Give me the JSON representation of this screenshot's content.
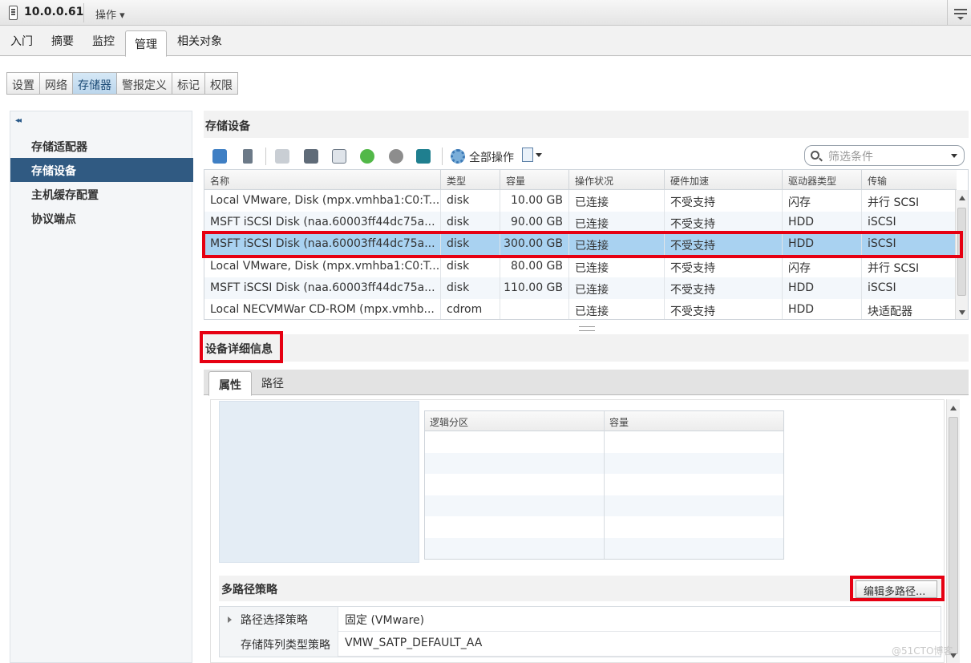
{
  "topbar": {
    "host": "10.0.0.61",
    "actions": "操作 ▾"
  },
  "main_tabs": [
    "入门",
    "摘要",
    "监控",
    "管理",
    "相关对象"
  ],
  "sub_tabs": [
    "设置",
    "网络",
    "存储器",
    "警报定义",
    "标记",
    "权限"
  ],
  "left_nav": {
    "collapse": "◂◂",
    "items": [
      "存储适配器",
      "存储设备",
      "主机缓存配置",
      "协议端点"
    ]
  },
  "storage": {
    "title": "存储设备",
    "all_actions": "全部操作",
    "filter_placeholder": "筛选条件",
    "columns": [
      "名称",
      "类型",
      "容量",
      "操作状况",
      "硬件加速",
      "驱动器类型",
      "传输"
    ],
    "rows": [
      [
        "Local VMware, Disk (mpx.vmhba1:C0:T...",
        "disk",
        "10.00 GB",
        "已连接",
        "不受支持",
        "闪存",
        "并行 SCSI"
      ],
      [
        "MSFT iSCSI Disk (naa.60003ff44dc75a...",
        "disk",
        "90.00 GB",
        "已连接",
        "不受支持",
        "HDD",
        "iSCSI"
      ],
      [
        "MSFT iSCSI Disk (naa.60003ff44dc75a...",
        "disk",
        "300.00 GB",
        "已连接",
        "不受支持",
        "HDD",
        "iSCSI"
      ],
      [
        "Local VMware, Disk (mpx.vmhba1:C0:T...",
        "disk",
        "80.00 GB",
        "已连接",
        "不受支持",
        "闪存",
        "并行 SCSI"
      ],
      [
        "MSFT iSCSI Disk (naa.60003ff44dc75a...",
        "disk",
        "110.00 GB",
        "已连接",
        "不受支持",
        "HDD",
        "iSCSI"
      ],
      [
        "Local NECVMWar CD-ROM (mpx.vmhb...",
        "cdrom",
        "",
        "已连接",
        "不受支持",
        "HDD",
        "块适配器"
      ]
    ]
  },
  "details": {
    "title": "设备详细信息",
    "tabs": [
      "属性",
      "路径"
    ],
    "partition_columns": [
      "逻辑分区",
      "容量"
    ]
  },
  "multipath": {
    "title": "多路径策略",
    "edit_button": "编辑多路径...",
    "rows": [
      {
        "label": "路径选择策略",
        "value": "固定 (VMware)"
      },
      {
        "label": "存储阵列类型策略",
        "value": "VMW_SATP_DEFAULT_AA"
      }
    ]
  },
  "watermark": "@51CTO博客"
}
